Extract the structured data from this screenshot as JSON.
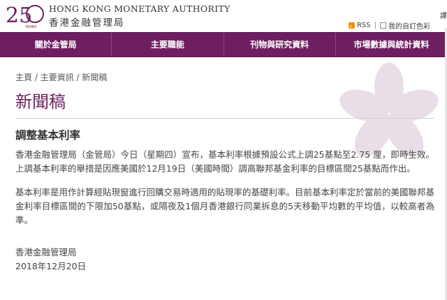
{
  "header": {
    "logo_number": "25",
    "logo_years": "YEARS",
    "org_name_en": "HONG KONG MONETARY AUTHORITY",
    "org_name_zh": "香港金融管理局",
    "utility": {
      "rss_label": "RSS",
      "color_label": "我的自訂色彩"
    },
    "edge_char": "譯"
  },
  "nav": {
    "items": [
      {
        "label": "關於金管局"
      },
      {
        "label": "主要職能"
      },
      {
        "label": "刊物與研究資料"
      },
      {
        "label": "市場數據與統計資料"
      }
    ]
  },
  "breadcrumb": {
    "home": "主頁",
    "sep1": " / ",
    "section": "主要資訊",
    "sep2": " / ",
    "current": "新聞稿"
  },
  "page_title": "新聞稿",
  "article": {
    "title": "調整基本利率",
    "paragraphs": [
      "香港金融管理局（金管局）今日（星期四）宣布，基本利率根據預設公式上調25基點至2.75 厘，即時生效。上調基本利率的舉措是因應美國於12月19日（美國時間）調高聯邦基金利率的目標區間25基點而作出。",
      "基本利率是用作計算經貼現窗進行回購交易時適用的貼現率的基礎利率。目前基本利率定於當前的美國聯邦基金利率目標區間的下限加50基點，或隔夜及1個月香港銀行同業拆息的5天移動平均數的平均值，以較高者為準。"
    ],
    "signature": "香港金融管理局",
    "date": "2018年12月20日"
  },
  "colors": {
    "brand_purple": "#6d1f62",
    "rss_orange": "#f39200"
  }
}
